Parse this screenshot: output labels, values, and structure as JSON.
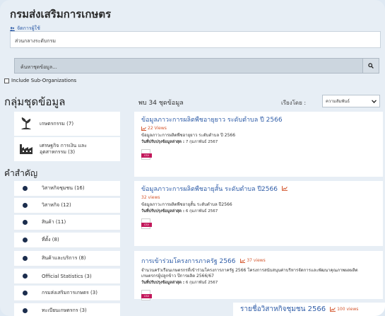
{
  "org": {
    "title": "กรมส่งเสริมการเกษตร",
    "manage_link": "จัดการผู้ใช้",
    "field_value": "ส่วนกลางระดับกรม"
  },
  "search": {
    "placeholder": "ค้นหาชุดข้อมูล..."
  },
  "include_sub_label": "Include Sub-Organizations",
  "groups": {
    "heading": "กลุ่มชุดข้อมูล",
    "items": [
      {
        "label": "เกษตรกรรม (7)",
        "icon": "plant-icon"
      },
      {
        "label": "เศรษฐกิจ การเงิน และ อุตสาหกรรม (3)",
        "icon": "factory-icon"
      }
    ]
  },
  "keywords": {
    "heading": "คำสำคัญ",
    "items": [
      "วิสาหกิจชุมชน (16)",
      "วิสาหกิจ (12)",
      "สินค้า (11)",
      "ที่ตั้ง (8)",
      "สินค้าและบริการ (8)",
      "Official Statistics (3)",
      "กรมส่งเสริมการเกษตร (3)",
      "ทะเบียนเกษตรกร (3)"
    ]
  },
  "results": {
    "count_text": "พบ 34 ชุดข้อมูล",
    "sort_label": "เรียงโดย :",
    "sort_value": "ความสัมพันธ์",
    "items": [
      {
        "title": "ข้อมูลภาวะการผลิตพืชอายุยาว ระดับตำบล ปี 2566",
        "views": "22 Views",
        "desc": "ข้อมูลภาวะการผลิตพืชอายุยาว ระดับตำบล ปี 2566",
        "updated_label": "วันที่ปรับปรุงข้อมูลล่าสุด :",
        "updated_value": "7 กุมภาพันธ์ 2567",
        "format": "CSV"
      },
      {
        "title": "ข้อมูลภาวะการผลิตพืชอายุสั้น ระดับตำบล ปี2566",
        "views": "32 views",
        "desc": "ข้อมูลภาวะการผลิตพืชอายุสั้น ระดับตำบล ปี2566",
        "updated_label": "วันที่ปรับปรุงข้อมูลล่าสุด :",
        "updated_value": "6 กุมภาพันธ์ 2567",
        "format": "CSV"
      },
      {
        "title": "การเข้าร่วมโครงการภาครัฐ 2566",
        "views": "37 views",
        "desc": "จำนวนครัวเรือนเกษตรกรที่เข้าร่วมโครงการภาครัฐ 2566 โครงการสนับสนุนค่าบริหารจัดการและพัฒนาคุณภาพผลผลิต เกษตรกรผู้ปลูกข้าว ปีการผลิต 2566/67",
        "updated_label": "วันที่ปรับปรุงข้อมูลล่าสุด :",
        "updated_value": "6 กุมภาพันธ์ 2567",
        "format": "CSV"
      }
    ],
    "partial": {
      "title": "รายชื่อวิสาหกิจชุมชน 2566",
      "views": "100 views"
    }
  },
  "colors": {
    "link": "#2f5da8",
    "views": "#d3542b",
    "csv_badge": "#c2185b",
    "bullet": "#1b2d4d"
  }
}
